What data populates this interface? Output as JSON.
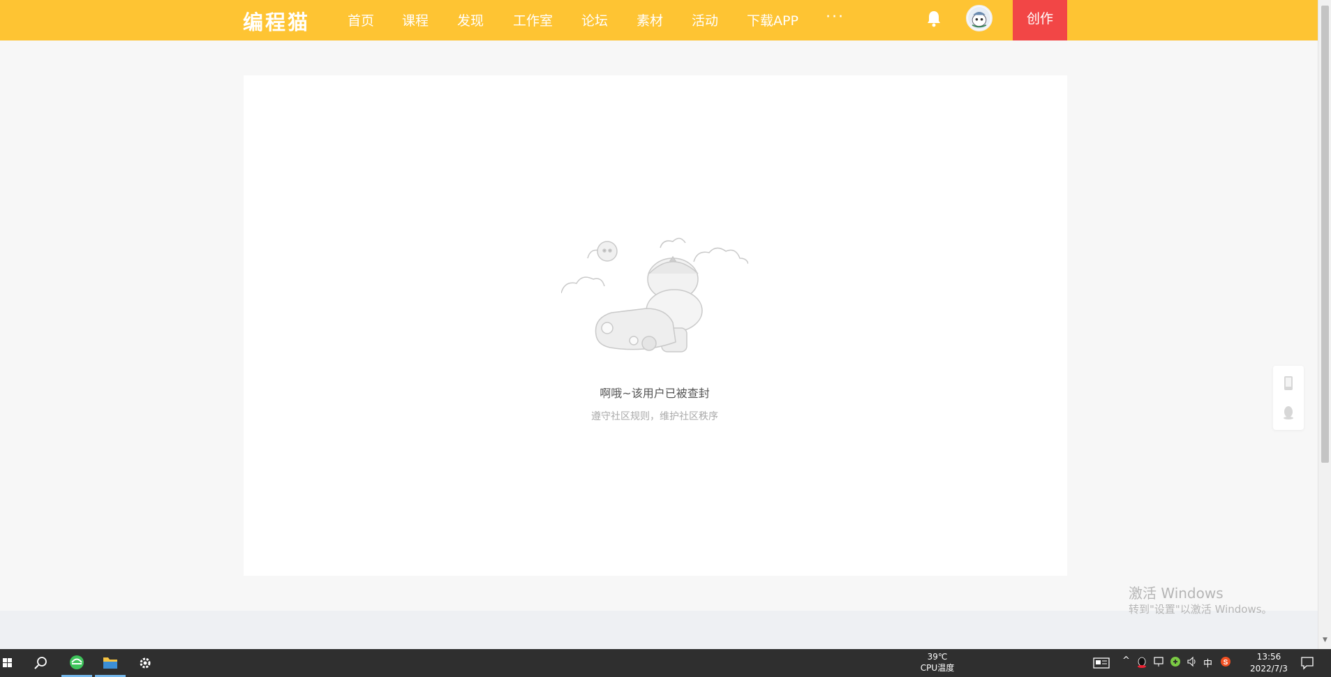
{
  "header": {
    "logo": "编程猫",
    "nav": [
      "首页",
      "课程",
      "发现",
      "工作室",
      "论坛",
      "素材",
      "活动",
      "下载APP"
    ],
    "more": "···",
    "create_label": "创作",
    "brand_color": "#fec433",
    "create_color": "#f24646"
  },
  "main": {
    "message_title": "啊哦~该用户已被查封",
    "message_sub": "遵守社区规则，维护社区秩序"
  },
  "watermark": {
    "title": "激活 Windows",
    "subtitle": "转到\"设置\"以激活 Windows。"
  },
  "taskbar": {
    "cpu_temp": "39℃",
    "cpu_label": "CPU温度",
    "ime": "中",
    "time": "13:56",
    "date": "2022/7/3"
  }
}
